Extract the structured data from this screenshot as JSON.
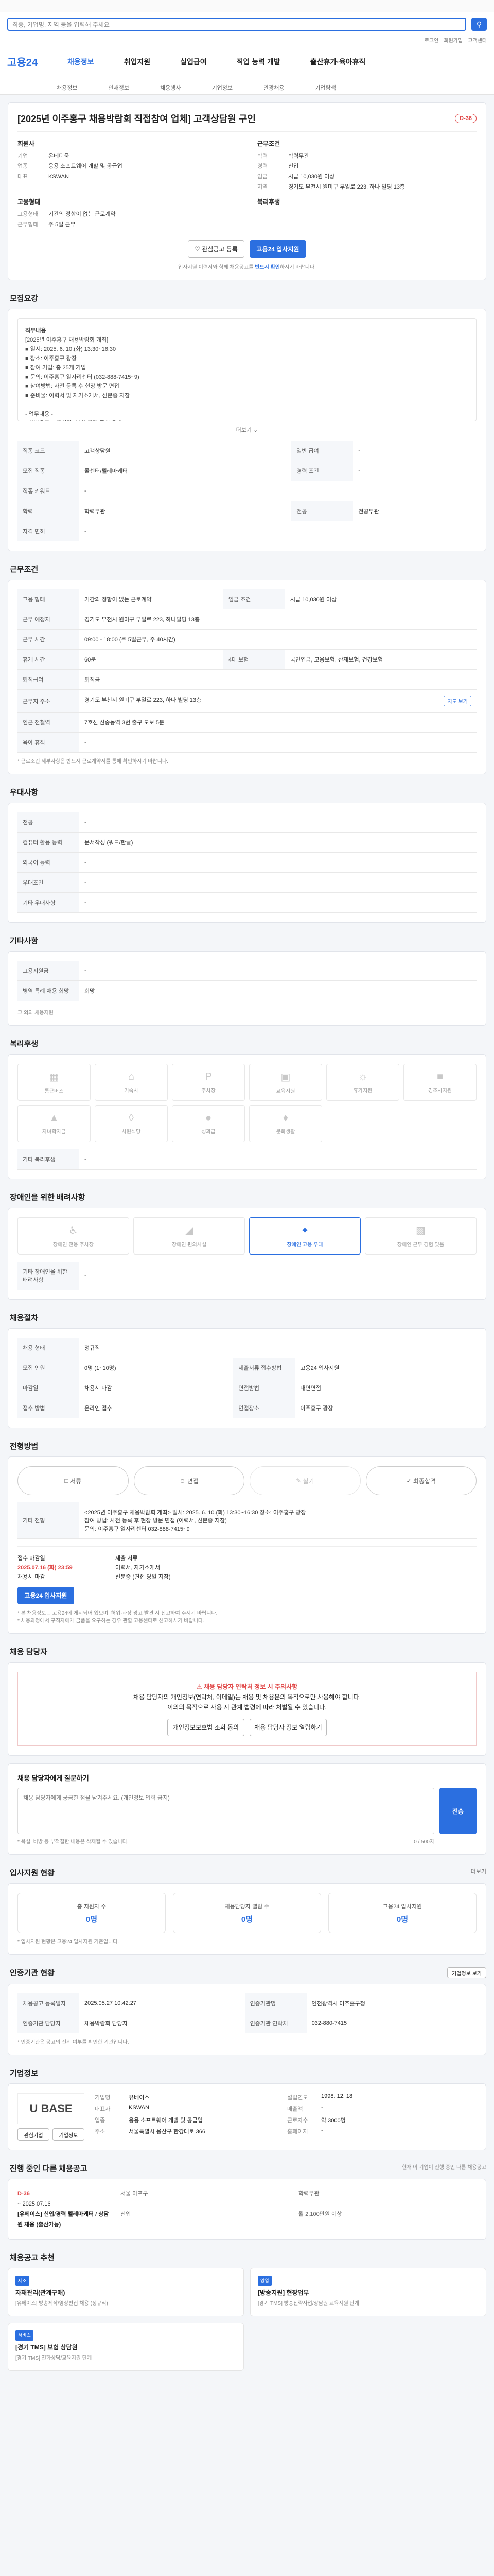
{
  "search": {
    "placeholder": "직종, 기업명, 지역 등을 입력해 주세요"
  },
  "util": [
    "로그인",
    "회원가입",
    "고객센터"
  ],
  "gnb": {
    "logo": "고용24",
    "menus": [
      "채용정보",
      "취업지원",
      "실업급여",
      "직업 능력 개발",
      "출산휴가·육아휴직"
    ]
  },
  "subnav": [
    "채용정보",
    "인재정보",
    "채용행사",
    "기업정보",
    "관광채용",
    "기업탐색"
  ],
  "posting": {
    "title": "[2025년 이주홍구 채용박람회 직접참여 업체] 고객상담원 구인",
    "dday": "D-36",
    "company_h": "회원사",
    "company": [
      [
        "기업",
        "온베디움"
      ],
      [
        "업종",
        "응용 소프트웨어 개발 및 공급업"
      ],
      [
        "대표",
        "KSWAN"
      ]
    ],
    "cond_h": "근무조건",
    "cond": [
      [
        "학력",
        "학력무관"
      ],
      [
        "경력",
        "신입"
      ],
      [
        "임금",
        "시급 10,030원 이상"
      ],
      [
        "지역",
        "경기도 부천시 원미구 부일로 223, 하나 빌딩 13층"
      ]
    ],
    "type_h": "고용형태",
    "type": [
      [
        "고용형태",
        "기간의 정함이 없는 근로계약"
      ],
      [
        "근무형태",
        "주 5일 근무"
      ]
    ],
    "welfare_h": "복리후생",
    "interest": "관심공고 등록",
    "apply": "고용24 입사지원",
    "notice_a": "입사지원 이력서와 함께 채용공고를 ",
    "notice_b": "반드시 확인",
    "notice_c": "하시기 바랍니다."
  },
  "detail": {
    "title": "모집요강",
    "heading": "직무내용",
    "body": "[2025년 이주홍구 채용박람회 개최]\n■ 일시: 2025. 6. 10.(화) 13:30~16:30\n■ 장소: 이주홍구 광장\n■ 참여 기업: 총 25개 기업\n■ 문의: 이주홍구 일자리센터 (032-888-7415~9)\n■ 참여방법: 사전 등록 후 현장 방문 면접\n■ 준비물: 이력서 및 자기소개서, 신분증 지참\n\n- 업무내용 -\n• 인바운드 고객상담 (보험 관련 문의 응대)\n• 고객 정보 확인 및 기본 안내\n• 상담 이력 관리 및 기록\n\n- 자격요건 -\n• 학력 무관\n• 신입 가능\n• 기본적인 컴퓨터 활용 가능자",
    "more": "더보기"
  },
  "recruit": [
    [
      "직종 코드",
      "고객상담원",
      "일반 급여",
      "-"
    ],
    [
      "모집 직종",
      "콜센터/텔레마케터",
      "경력 조건",
      "-"
    ],
    [
      "직종 키워드",
      "-",
      "",
      ""
    ],
    [
      "학력",
      "학력무관",
      "전공",
      "전공무관"
    ],
    [
      "자격 면허",
      "-",
      "",
      ""
    ]
  ],
  "conditions": {
    "title": "근무조건",
    "rows": [
      [
        "고용 형태",
        "기간의 정함이 없는 근로계약",
        "임금 조건",
        "시급 10,030원 이상"
      ],
      [
        "근무 예정지",
        "경기도 부천시 원미구 부일로 223, 하나빌딩 13층",
        "",
        ""
      ],
      [
        "근무 시간",
        "09:00 - 18:00 (주 5일근무, 주 40시간)",
        "",
        ""
      ],
      [
        "휴게 시간",
        "60분",
        "4대 보험",
        "국민연금, 고용보험, 산재보험, 건강보험"
      ],
      [
        "퇴직급여",
        "퇴직금",
        "",
        ""
      ],
      [
        "근무지 주소",
        "경기도 부천시 원미구 부일로 223, 하나 빌딩 13층",
        "",
        ""
      ],
      [
        "인근 전철역",
        "7호선 신중동역 3번 출구 도보 5분",
        "",
        ""
      ],
      [
        "육아 휴직",
        "-",
        "",
        ""
      ]
    ],
    "tag": "지도 보기",
    "foot": "* 근로조건 세부사항은 반드시 근로계약서를 통해 확인하시기 바랍니다."
  },
  "special": {
    "title": "우대사항",
    "rows": [
      [
        "전공",
        "-"
      ],
      [
        "컴퓨터 활용 능력",
        "문서작성 (워드/한글)"
      ],
      [
        "외국어 능력",
        "-"
      ],
      [
        "우대조건",
        "-"
      ],
      [
        "기타 우대사항",
        "-"
      ]
    ]
  },
  "etc": {
    "title": "기타사항",
    "rows": [
      [
        "고용지원금",
        "-"
      ],
      [
        "병역 특례 채용 희망",
        "희망"
      ]
    ],
    "note": "그 외의 채용지원"
  },
  "welfare": {
    "title": "복리후생",
    "items": [
      "통근버스",
      "기숙사",
      "주차장",
      "교육지원",
      "휴가지원",
      "경조사지원",
      "자녀학자금",
      "사원식당",
      "성과급",
      "문화생활"
    ],
    "active": []
  },
  "welfare_note": {
    "label": "기타 복리후생",
    "value": "-"
  },
  "disability": {
    "title": "장애인을 위한 배려사항",
    "items": [
      "장애인 전용 주차장",
      "장애인 편의시설",
      "장애인 고용 우대",
      "장애인 근무 경험 있음"
    ],
    "active_index": 2,
    "label": "기타 장애인을 위한 배려사항",
    "value": "-"
  },
  "process": {
    "title": "채용절차",
    "rows": [
      [
        "채용 형태",
        "정규직",
        "",
        ""
      ],
      [
        "모집 인원",
        "0명 (1~10명)",
        "제출서류 접수방법",
        "고용24 입사지원"
      ],
      [
        "마감일",
        "채용시 마감",
        "면접방법",
        "대면면접"
      ],
      [
        "접수 방법",
        "온라인 접수",
        "면접장소",
        "이주홍구 광장"
      ]
    ]
  },
  "screening": {
    "title": "전형방법",
    "steps": [
      "서류",
      "면접",
      "실기",
      "최종합격"
    ],
    "dim": [
      2
    ],
    "label": "기타 전형",
    "text": "<2025년 이주홍구 채용박람회 개최> 일시: 2025. 6. 10.(화) 13:30~16:30 장소: 이주홍구 광장\n참여 방법: 사전 등록 후 현장 방문 면접 (이력서, 신분증 지참)\n문의: 이주홍구 일자리센터 032-888-7415~9",
    "apply_label": "접수 마감일",
    "apply_date": "2025.07.16 (화) 23:59",
    "apply_sub": "채용시 마감",
    "apply_btn": "고용24 입사지원",
    "place_label": "제출 서류",
    "place_text": "이력서, 자기소개서\n신분증 (면접 당일 지참)",
    "foot": "* 본 채용정보는 고용24에 게시되어 있으며, 허위·과장 광고 발견 시 신고하여 주시기 바랍니다.\n* 채용과정에서 구직자에게 금품을 요구하는 경우 관할 고용센터로 신고하시기 바랍니다."
  },
  "contact": {
    "title": "채용 담당자",
    "alert1": "채용 담당자 연락처 정보 시 주의사항",
    "alert2": "채용 담당자의 개인정보(연락처, 이메일)는 채용 및 채용문의 목적으로만 사용해야 합니다.",
    "alert3": "이외의 목적으로 사용 시 관계 법령에 따라 처벌될 수 있습니다.",
    "btn1": "개인정보보호법 조회 동의",
    "btn2": "채용 담당자 정보 열람하기"
  },
  "qna": {
    "title": "채용 담당자에게 질문하기",
    "placeholder": "채용 담당자에게 궁금한 점을 남겨주세요. (개인정보 입력 금지)",
    "count": "0 / 500자",
    "btn": "전송",
    "note": "* 욕설, 비방 등 부적절한 내용은 삭제될 수 있습니다."
  },
  "stats": {
    "title": "입사지원 현황",
    "more": "더보기",
    "items": [
      [
        "총 지원자 수",
        "0명"
      ],
      [
        "채용담당자 열람 수",
        "0명"
      ],
      [
        "고용24 입사지원",
        "0명"
      ]
    ],
    "note": "* 입사지원 현황은 고용24 입사지원 기준입니다."
  },
  "info": {
    "title": "인증기관 현황",
    "btn": "기업정보 보기",
    "rows": [
      [
        "채용공고 등록일자",
        "2025.05.27 10:42:27",
        "인증기관명",
        "인천광역시 미추홀구청"
      ],
      [
        "인증기관 담당자",
        "채용박람회 담당자",
        "인증기관 연락처",
        "032-880-7415"
      ]
    ],
    "foot": "* 인증기관은 공고의 진위 여부를 확인한 기관입니다."
  },
  "company": {
    "title": "기업정보",
    "logo": "U BASE",
    "btn1": "관심기업",
    "btn2": "기업정보",
    "rows": [
      [
        "기업명",
        "유베이스",
        "설립연도",
        "1998. 12. 18"
      ],
      [
        "대표자",
        "KSWAN",
        "매출액",
        "-"
      ],
      [
        "업종",
        "응용 소프트웨어 개발 및 공급업",
        "근로자수",
        "약 3000명"
      ],
      [
        "주소",
        "서울특별시 용산구 한강대로 366",
        "홈페이지",
        "-"
      ]
    ]
  },
  "ongoing": {
    "title": "진행 중인 다른 채용공고",
    "sub": "현재 이 기업이 진행 중인 다른 채용공고",
    "dday": "D-36",
    "date": "~ 2025.07.16",
    "title2": "[유베이스] 신입/경력 텔레마케터 / 상담원 채용 (출산가능)",
    "meta": [
      "서울 마포구",
      "학력무관",
      "신입",
      "월 2,100만원 이상"
    ]
  },
  "related": {
    "title": "채용공고 추천",
    "items": [
      {
        "label": "제조",
        "title": "자재관리(관계구매)",
        "m": "[유베이스] 방송제작/영상편집 채용 (정규직)"
      },
      {
        "label": "영업",
        "title": "[방송지원] 현장업무",
        "m": "[경기 TMS] 방송전략사업/상담원 교육지원 단계"
      },
      {
        "label": "서비스",
        "title": "[경기 TMS] 보험 상담원",
        "m": "[경기 TMS] 전화상담/교육지원 단계"
      }
    ]
  }
}
